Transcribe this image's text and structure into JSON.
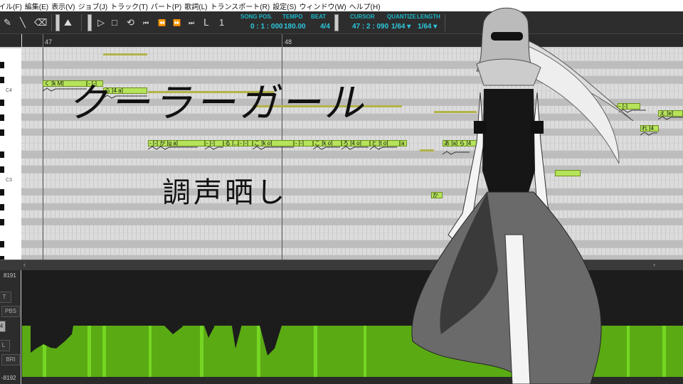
{
  "menu": [
    "イル(F)",
    "編集(E)",
    "表示(V)",
    "ジョブ(J)",
    "トラック(T)",
    "パート(P)",
    "歌詞(L)",
    "トランスポート(R)",
    "設定(S)",
    "ウィンドウ(W)",
    "ヘルプ(H)"
  ],
  "toolbar": {
    "song_pos_label": "SONG POS.",
    "song_pos": "0 : 1 : 000",
    "tempo_label": "TEMPO",
    "tempo": "180.00",
    "beat_label": "BEAT",
    "beat": "4/4",
    "cursor_label": "CURSOR",
    "cursor": "47 : 2 : 090",
    "quantize_label": "QUANTIZE",
    "quantize": "1/64 ▾",
    "length_label": "LENGTH",
    "length": "1/64 ▾",
    "icons": [
      "pencil-icon",
      "line-icon",
      "eraser-icon",
      "pitch-icon",
      "play-icon",
      "stop-icon",
      "loop-icon",
      "start-icon",
      "rewind-icon",
      "forward-icon",
      "end-icon",
      "marker-icon",
      "count-icon"
    ]
  },
  "ruler": {
    "measures": [
      "47",
      "48"
    ]
  },
  "keys": {
    "c4": "C4",
    "c3": "C3"
  },
  "notes": [
    "く [k M]",
    "- [-]",
    "ら [4 a]",
    "- [-] が [g a]",
    "- [-]",
    "る [...]",
    "- [-]",
    "こ [k o]",
    "- [-]",
    "こ [k o]",
    "ろ [4 o]",
    "と [t o]",
    "a",
    "あ [a] ら [4",
    "か_",
    "- [-]",
    "え [e]",
    "れ [4_",
    ""
  ],
  "overlay": {
    "title": "クーラーガール",
    "subtitle": "調声晒し"
  },
  "control": {
    "max": "8191",
    "min": "-8192",
    "param1": "T",
    "param2": "PBS",
    "param3": "4",
    "param4": "L",
    "param5": "BRI"
  },
  "colors": {
    "accent": "#2cc8dc",
    "note": "#b5e35a",
    "param": "#5aaa14"
  }
}
